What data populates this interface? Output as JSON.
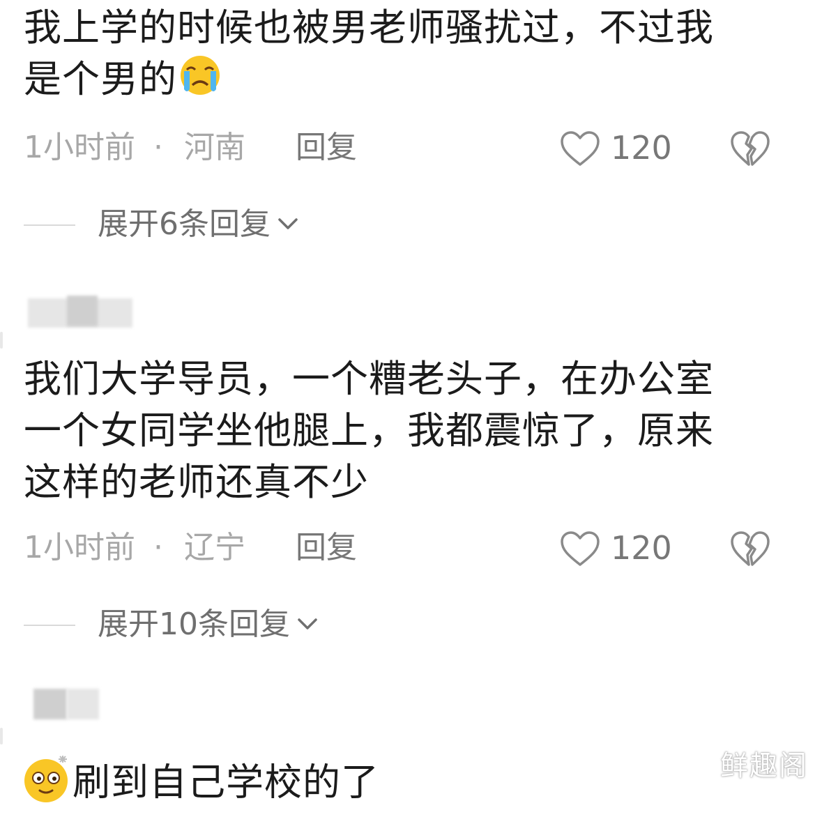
{
  "comments": [
    {
      "lines": [
        "我上学的时候也被男老师骚扰过，不过我",
        "是个男的"
      ],
      "emoji": "crying-face-emoji",
      "time": "1小时前",
      "separator": "·",
      "location": "河南",
      "reply_label": "回复",
      "like_count": "120",
      "expand_label": "展开6条回复"
    },
    {
      "lines": [
        "我们大学导员，一个糟老头子，在办公室",
        "一个女同学坐他腿上，我都震惊了，原来",
        "这样的老师还真不少"
      ],
      "time": "1小时前",
      "separator": "·",
      "location": "辽宁",
      "reply_label": "回复",
      "like_count": "120",
      "expand_label": "展开10条回复"
    },
    {
      "lines": [
        "刷到自己学校的了"
      ],
      "emoji": "dazed-smiley-emoji"
    }
  ],
  "icons": {
    "like": "heart-outline-icon",
    "dislike": "broken-heart-icon",
    "expand": "chevron-down-icon"
  },
  "watermark": "鲜趣阁",
  "colors": {
    "text": "#1b1b1b",
    "meta": "#a7a7a7",
    "action": "#777777",
    "icon": "#8a8a8a"
  }
}
